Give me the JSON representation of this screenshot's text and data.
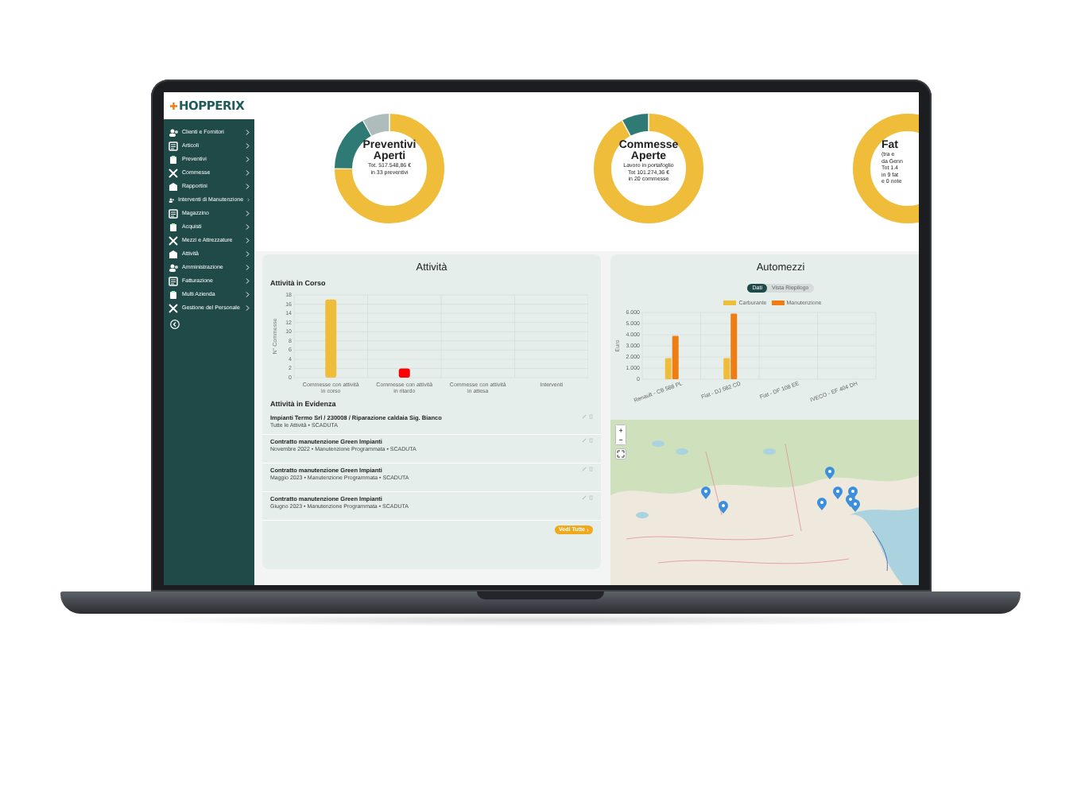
{
  "logo": {
    "text": "HOPPERIX"
  },
  "sidebar": {
    "items": [
      {
        "label": "Clienti e Fornitori"
      },
      {
        "label": "Articoli"
      },
      {
        "label": "Preventivi"
      },
      {
        "label": "Commesse"
      },
      {
        "label": "Rapportini"
      },
      {
        "label": "Interventi di Manutenzione"
      },
      {
        "label": "Magazzino"
      },
      {
        "label": "Acquisti"
      },
      {
        "label": "Mezzi e Attrezzature"
      },
      {
        "label": "Attività"
      },
      {
        "label": "Amministrazione"
      },
      {
        "label": "Fatturazione"
      },
      {
        "label": "Multi Azienda"
      },
      {
        "label": "Gestione del Personale"
      }
    ]
  },
  "kpis": [
    {
      "kind": "full",
      "title": "Preventivi Aperti",
      "lines": [
        "Tot. 517.548,86 €",
        "in 33 preventivi"
      ]
    },
    {
      "kind": "full",
      "title": "Commesse Aperte",
      "lines": [
        "Lavoro in portafoglio",
        "Tot 101.274,36 €",
        "in 20 commesse"
      ]
    },
    {
      "kind": "cut",
      "title": "Fat",
      "lines": [
        "(tra e",
        "da Genn",
        "Tot 1.4",
        "in 9 fat",
        "e 0 note"
      ]
    }
  ],
  "activity": {
    "title": "Attività",
    "in_progress": {
      "heading": "Attività in Corso",
      "chart_data": {
        "type": "bar",
        "grid": true,
        "ylabel": "N° Commesse",
        "categories": [
          "Commesse con attività in corso",
          "Commesse con attività in ritardo",
          "Commesse con attività in attesa",
          "Interventi"
        ],
        "values": [
          17,
          2,
          0,
          0
        ],
        "colors": [
          "#f0bd3a",
          "#ff0000",
          "#f0bd3a",
          "#f0bd3a"
        ],
        "ylim": [
          0,
          18
        ],
        "yticks": [
          0,
          2,
          4,
          6,
          8,
          10,
          12,
          14,
          16,
          18
        ]
      }
    },
    "highlights": {
      "heading": "Attività in Evidenza",
      "items": [
        {
          "title": "Impianti Termo Srl / 230008 / Riparazione caldaia Sig. Bianco",
          "subtitle": "Tutte le Attività • SCADUTA"
        },
        {
          "title": "Contratto manutenzione Green Impianti",
          "subtitle": "Novembre 2022 • Manutenzione Programmata • SCADUTA"
        },
        {
          "title": "Contratto manutenzione Green Impianti",
          "subtitle": "Maggio 2023 • Manutenzione Programmata • SCADUTA"
        },
        {
          "title": "Contratto manutenzione Green Impianti",
          "subtitle": "Giugno 2023 • Manutenzione Programmata • SCADUTA"
        }
      ],
      "button": "Vedi Tutte"
    }
  },
  "fleet": {
    "title": "Automezzi",
    "toggles": [
      {
        "label": "Dati",
        "selected": true
      },
      {
        "label": "Vista Riepilogo",
        "selected": false
      }
    ],
    "chart_data": {
      "type": "bar",
      "grid": true,
      "ylabel": "Euro",
      "categories": [
        "Renault - CB 588 PL",
        "Fiat - DJ 582 CD",
        "Fiat - DF 108 EE",
        "IVECO - EF 404 DH"
      ],
      "series": [
        {
          "name": "Carburante",
          "color": "#f0bd3a",
          "values": [
            1900,
            1900,
            0,
            0
          ]
        },
        {
          "name": "Manutenzione",
          "color": "#ee7d14",
          "values": [
            3900,
            5900,
            0,
            0
          ]
        }
      ],
      "ylim": [
        0,
        6000
      ],
      "yticks": [
        {
          "value": 0,
          "label": "0"
        },
        {
          "value": 1000,
          "label": "1.000"
        },
        {
          "value": 2000,
          "label": "2.000"
        },
        {
          "value": 3000,
          "label": "3.000"
        },
        {
          "value": 4000,
          "label": "4.000"
        },
        {
          "value": 5000,
          "label": "5.000"
        },
        {
          "value": 6000,
          "label": "6.000"
        }
      ]
    },
    "map": {
      "zoom_in": "+",
      "zoom_out": "−"
    }
  }
}
